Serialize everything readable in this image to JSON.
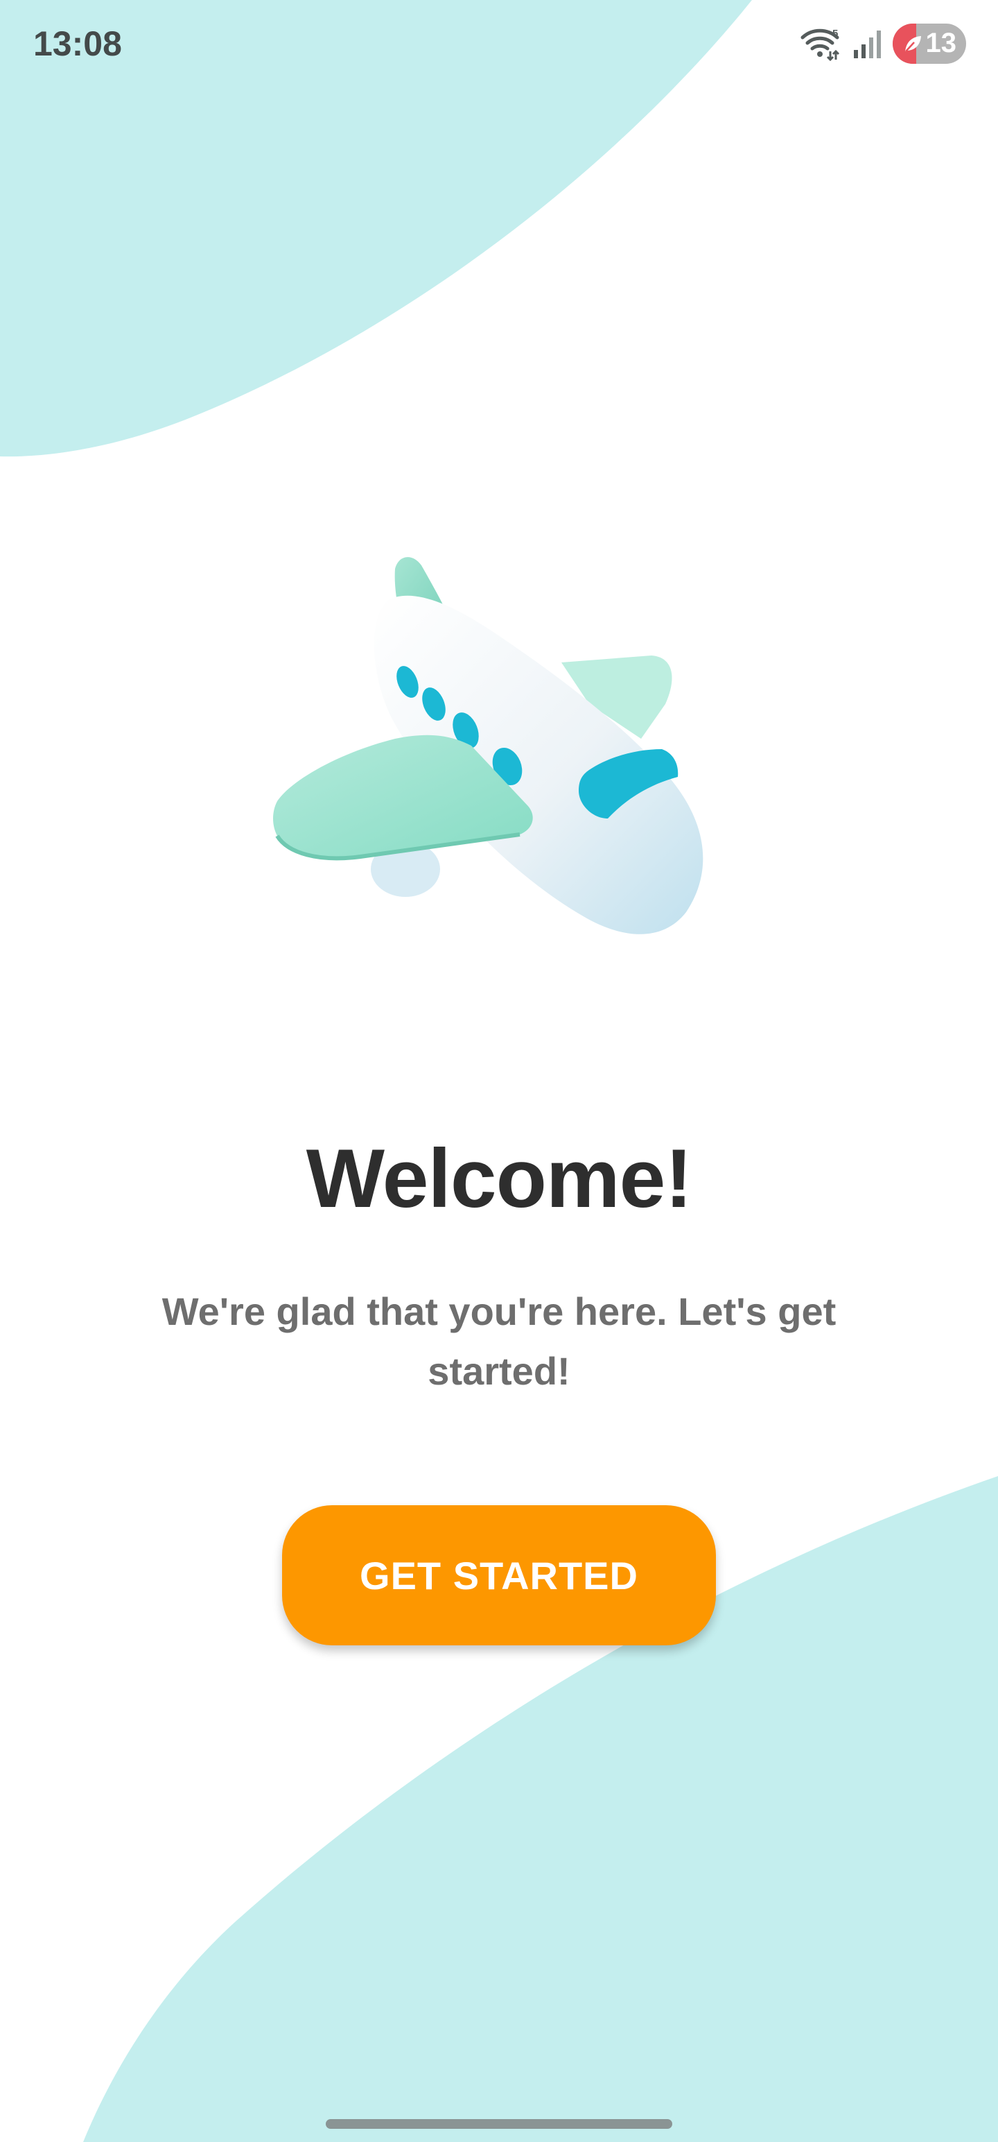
{
  "status_bar": {
    "time": "13:08",
    "battery_level": "13",
    "wifi_badge": "5",
    "icons": [
      "wifi-icon",
      "signal-icon",
      "battery-icon"
    ]
  },
  "welcome": {
    "title": "Welcome!",
    "subtitle": "We're glad that you're here. Let's get started!",
    "cta_label": "GET STARTED"
  },
  "illustration": {
    "icon": "airplane-illustration"
  },
  "colors": {
    "accent": "#fd9700",
    "blob": "#c4eeee",
    "title": "#2e2e2e",
    "subtitle": "#6e6e6e",
    "plane_body": "#eef4f8",
    "plane_wing": "#9fe2cf",
    "plane_window": "#1cb8d4"
  }
}
